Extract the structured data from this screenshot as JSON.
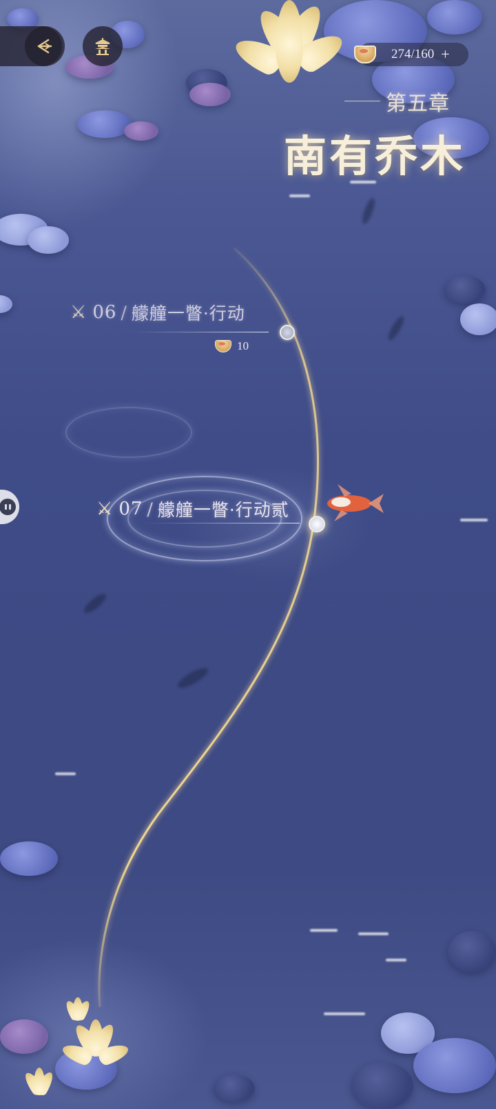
{
  "header": {
    "back_icon": "back-arrow-icon",
    "home_icon": "pavilion-icon",
    "currency": {
      "icon": "bowl-icon",
      "value": "274/160",
      "plus": "+"
    }
  },
  "chapter": {
    "subtitle": "第五章",
    "title": "南有乔木"
  },
  "stages": [
    {
      "number": "06",
      "name": "艨艟一瞥·行动",
      "cost": "10",
      "state": "cleared"
    },
    {
      "number": "07",
      "name": "艨艟一瞥·行动贰",
      "state": "current"
    }
  ],
  "side_button": {
    "icon": "pause-icon"
  },
  "colors": {
    "gold_path": "#f3d78f",
    "water": "#3f4c88",
    "accent_text": "#f7efd9"
  }
}
